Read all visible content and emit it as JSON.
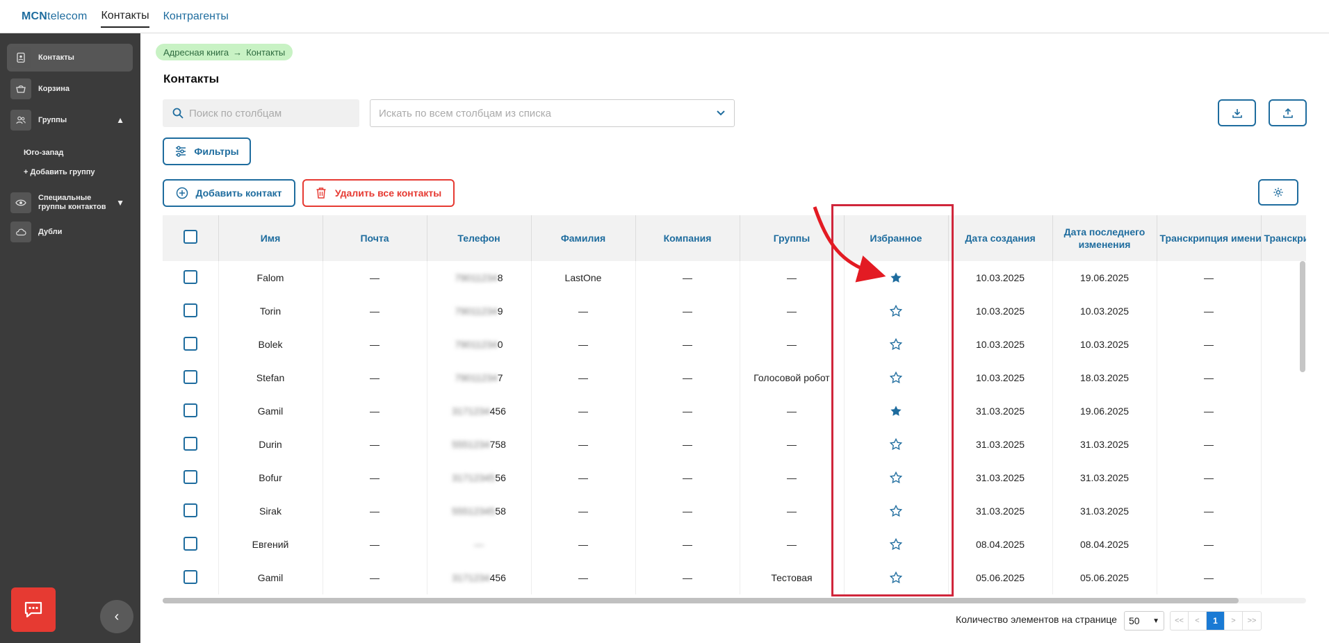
{
  "topbar": {
    "logo_bold": "MCN",
    "logo_rest": "telecom",
    "tabs": [
      {
        "label": "Контакты",
        "active": true
      },
      {
        "label": "Контрагенты",
        "active": false
      }
    ]
  },
  "sidebar": {
    "items": [
      {
        "label": "Контакты",
        "icon": "contact-book-icon",
        "active": true
      },
      {
        "label": "Корзина",
        "icon": "basket-icon"
      },
      {
        "label": "Группы",
        "icon": "users-icon"
      },
      {
        "label": "Специальные группы контактов",
        "icon": "eye-icon"
      },
      {
        "label": "Дубли",
        "icon": "cloud-icon"
      }
    ],
    "group_sub": [
      "Юго-запад",
      "+ Добавить группу"
    ]
  },
  "breadcrumb": {
    "root": "Адресная книга",
    "current": "Контакты"
  },
  "page_title": "Контакты",
  "search": {
    "placeholder": "Поиск по столбцам"
  },
  "column_select": {
    "placeholder": "Искать по всем столбцам из списка"
  },
  "buttons": {
    "filters": "Фильтры",
    "add_contact": "Добавить контакт",
    "delete_all": "Удалить все контакты"
  },
  "table": {
    "columns": [
      "Имя",
      "Почта",
      "Телефон",
      "Фамилия",
      "Компания",
      "Группы",
      "Избранное",
      "Дата создания",
      "Дата последнего изменения",
      "Транскрипция имени",
      "Транскрип"
    ],
    "rows": [
      {
        "name": "Falom",
        "email": "—",
        "phone_hidden": "79011234",
        "phone_tail": "8",
        "last": "LastOne",
        "company": "—",
        "groups": "—",
        "fav": true,
        "created": "10.03.2025",
        "modified": "19.06.2025",
        "trans": "—"
      },
      {
        "name": "Torin",
        "email": "—",
        "phone_hidden": "79011234",
        "phone_tail": "9",
        "last": "—",
        "company": "—",
        "groups": "—",
        "fav": false,
        "created": "10.03.2025",
        "modified": "10.03.2025",
        "trans": "—"
      },
      {
        "name": "Bolek",
        "email": "—",
        "phone_hidden": "79011234",
        "phone_tail": "0",
        "last": "—",
        "company": "—",
        "groups": "—",
        "fav": false,
        "created": "10.03.2025",
        "modified": "10.03.2025",
        "trans": "—"
      },
      {
        "name": "Stefan",
        "email": "—",
        "phone_hidden": "79011234",
        "phone_tail": "7",
        "last": "—",
        "company": "—",
        "groups": "Голосовой робот",
        "fav": false,
        "created": "10.03.2025",
        "modified": "18.03.2025",
        "trans": "—"
      },
      {
        "name": "Gamil",
        "email": "—",
        "phone_hidden": "3171234",
        "phone_tail": "456",
        "last": "—",
        "company": "—",
        "groups": "—",
        "fav": true,
        "created": "31.03.2025",
        "modified": "19.06.2025",
        "trans": "—"
      },
      {
        "name": "Durin",
        "email": "—",
        "phone_hidden": "5551234",
        "phone_tail": "758",
        "last": "—",
        "company": "—",
        "groups": "—",
        "fav": false,
        "created": "31.03.2025",
        "modified": "31.03.2025",
        "trans": "—"
      },
      {
        "name": "Bofur",
        "email": "—",
        "phone_hidden": "31712345",
        "phone_tail": "56",
        "last": "—",
        "company": "—",
        "groups": "—",
        "fav": false,
        "created": "31.03.2025",
        "modified": "31.03.2025",
        "trans": "—"
      },
      {
        "name": "Sirak",
        "email": "—",
        "phone_hidden": "55512345",
        "phone_tail": "58",
        "last": "—",
        "company": "—",
        "groups": "—",
        "fav": false,
        "created": "31.03.2025",
        "modified": "31.03.2025",
        "trans": "—"
      },
      {
        "name": "Евгений",
        "email": "—",
        "phone_hidden": "—",
        "phone_tail": "",
        "last": "—",
        "company": "—",
        "groups": "—",
        "fav": false,
        "created": "08.04.2025",
        "modified": "08.04.2025",
        "trans": "—"
      },
      {
        "name": "Gamil",
        "email": "—",
        "phone_hidden": "3171234",
        "phone_tail": "456",
        "last": "—",
        "company": "—",
        "groups": "Тестовая",
        "fav": false,
        "created": "05.06.2025",
        "modified": "05.06.2025",
        "trans": "—"
      }
    ]
  },
  "pagination": {
    "label": "Количество элементов на странице",
    "per_page": "50",
    "first": "<<",
    "prev": "<",
    "current": "1",
    "next": ">",
    "last": ">>"
  },
  "colors": {
    "accent": "#1e6c9e",
    "danger": "#e63a32",
    "highlight": "#d0263b",
    "sidebar": "#3b3b3b"
  }
}
